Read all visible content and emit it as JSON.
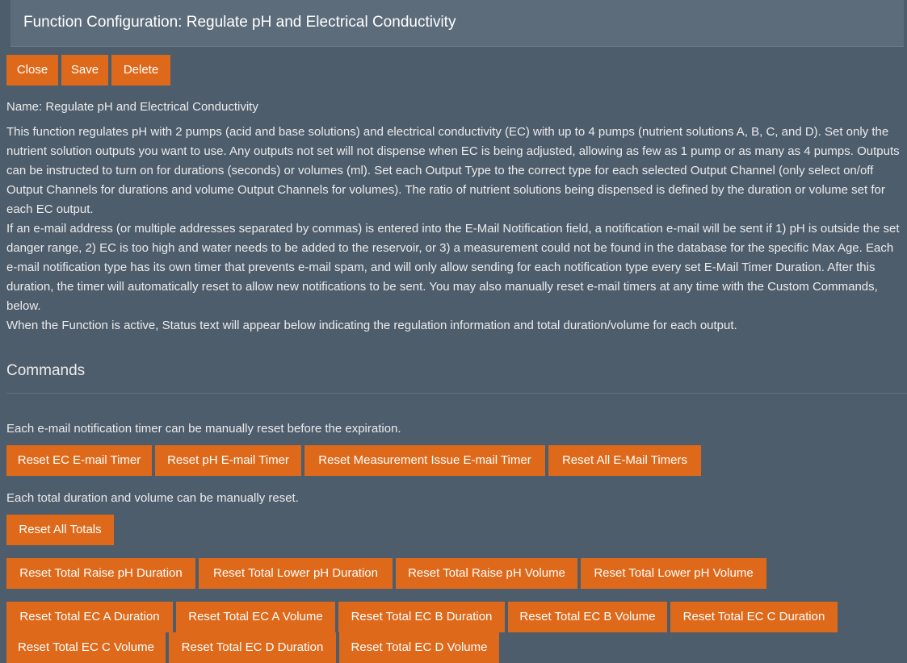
{
  "header": {
    "title": "Function Configuration: Regulate pH and Electrical Conductivity"
  },
  "actions": {
    "close": "Close",
    "save": "Save",
    "delete": "Delete"
  },
  "function": {
    "name_line": "Name: Regulate pH and Electrical Conductivity",
    "description": [
      "This function regulates pH with 2 pumps (acid and base solutions) and electrical conductivity (EC) with up to 4 pumps (nutrient solutions A, B, C, and D). Set only the nutrient solution outputs you want to use. Any outputs not set will not dispense when EC is being adjusted, allowing as few as 1 pump or as many as 4 pumps. Outputs can be instructed to turn on for durations (seconds) or volumes (ml). Set each Output Type to the correct type for each selected Output Channel (only select on/off Output Channels for durations and volume Output Channels for volumes). The ratio of nutrient solutions being dispensed is defined by the duration or volume set for each EC output.",
      "If an e-mail address (or multiple addresses separated by commas) is entered into the E-Mail Notification field, a notification e-mail will be sent if 1) pH is outside the set danger range, 2) EC is too high and water needs to be added to the reservoir, or 3) a measurement could not be found in the database for the specific Max Age. Each e-mail notification type has its own timer that prevents e-mail spam, and will only allow sending for each notification type every set E-Mail Timer Duration. After this duration, the timer will automatically reset to allow new notifications to be sent. You may also manually reset e-mail timers at any time with the Custom Commands, below.",
      "When the Function is active, Status text will appear below indicating the regulation information and total duration/volume for each output."
    ]
  },
  "commands": {
    "title": "Commands",
    "email_note": "Each e-mail notification timer can be manually reset before the expiration.",
    "email_buttons": [
      "Reset EC E-mail Timer",
      "Reset pH E-mail Timer",
      "Reset Measurement Issue E-mail Timer",
      "Reset All E-Mail Timers"
    ],
    "totals_note": "Each total duration and volume can be manually reset.",
    "reset_all_totals": "Reset All Totals",
    "ph_buttons": [
      "Reset Total Raise pH Duration",
      "Reset Total Lower pH Duration",
      "Reset Total Raise pH Volume",
      "Reset Total Lower pH Volume"
    ],
    "ec_buttons": [
      "Reset Total EC A Duration",
      "Reset Total EC A Volume",
      "Reset Total EC B Duration",
      "Reset Total EC B Volume",
      "Reset Total EC C Duration",
      "Reset Total EC C Volume",
      "Reset Total EC D Duration",
      "Reset Total EC D Volume"
    ]
  },
  "colors": {
    "background": "#4e5d6c",
    "header": "#5d6c7b",
    "button": "#df691a",
    "text": "#ebebeb"
  }
}
